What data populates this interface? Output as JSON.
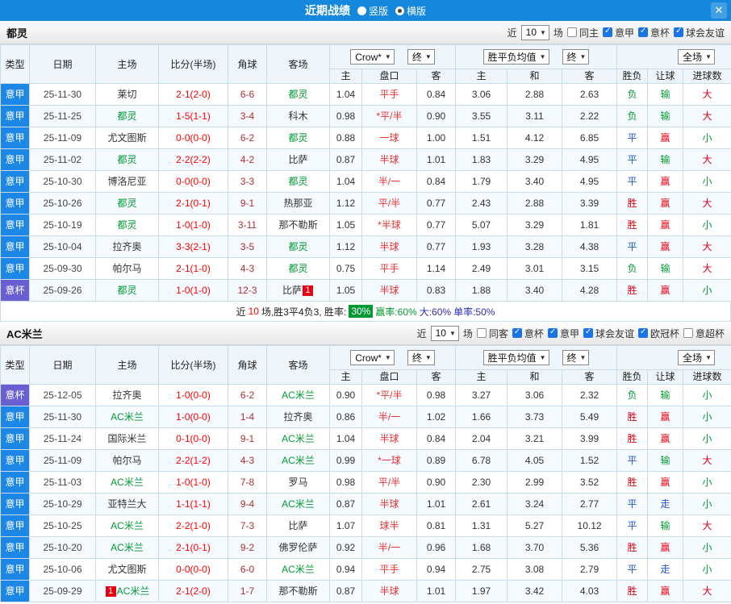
{
  "topbar": {
    "title": "近期战绩",
    "radios": [
      {
        "label": "竖版",
        "selected": false
      },
      {
        "label": "横版",
        "selected": true
      }
    ],
    "close": "✕"
  },
  "colors": {
    "topbar_bg": "#1587dd",
    "league": {
      "意甲": "#1d87e6",
      "意杯": "#6a5fd2"
    },
    "team_highlight": "#009933",
    "score": "#ff0000",
    "corner": "#b03030",
    "handicap_text": "#e83333",
    "result": {
      "胜": "#e60012",
      "平": "#2356c7",
      "负": "#009933"
    },
    "let": {
      "赢": "#e60012",
      "走": "#2356c7",
      "输": "#009933"
    },
    "goals": {
      "大": "#e60012",
      "小": "#009933"
    },
    "summary": {
      "count": "#ff0000",
      "badge_bg": "#009933",
      "win": "#009933",
      "big": "#2d2db8",
      "single": "#2d2db8"
    }
  },
  "table_header": {
    "cols": [
      "类型",
      "日期",
      "主场",
      "比分(半场)",
      "角球",
      "客场"
    ],
    "odds_selects": [
      "Crow*",
      "终"
    ],
    "odds_sub": [
      "主",
      "盘口",
      "客"
    ],
    "avg_selects": [
      "胜平负均值",
      "终"
    ],
    "avg_sub": [
      "主",
      "和",
      "客"
    ],
    "scope_select": "全场",
    "result_sub": [
      "胜负",
      "让球",
      "进球数"
    ]
  },
  "sections": [
    {
      "team": "都灵",
      "filter": {
        "prefix": "近",
        "count": "10",
        "suffix": "场",
        "checks": [
          {
            "label": "同主",
            "checked": false
          },
          {
            "label": "意甲",
            "checked": true
          },
          {
            "label": "意杯",
            "checked": true
          },
          {
            "label": "球会友谊",
            "checked": true
          }
        ]
      },
      "rows": [
        {
          "type": "意甲",
          "date": "25-11-30",
          "home": "莱切",
          "score": "2-1(2-0)",
          "corner": "6-6",
          "away": "都灵",
          "odds": [
            "1.04",
            "平手",
            "0.84"
          ],
          "avg": [
            "3.06",
            "2.88",
            "2.63"
          ],
          "result": "负",
          "let": "输",
          "goals": "大"
        },
        {
          "type": "意甲",
          "date": "25-11-25",
          "home": "都灵",
          "score": "1-5(1-1)",
          "corner": "3-4",
          "away": "科木",
          "odds": [
            "0.98",
            "*平/半",
            "0.90"
          ],
          "avg": [
            "3.55",
            "3.11",
            "2.22"
          ],
          "result": "负",
          "let": "输",
          "goals": "大"
        },
        {
          "type": "意甲",
          "date": "25-11-09",
          "home": "尤文图斯",
          "score": "0-0(0-0)",
          "corner": "6-2",
          "away": "都灵",
          "odds": [
            "0.88",
            "一球",
            "1.00"
          ],
          "avg": [
            "1.51",
            "4.12",
            "6.85"
          ],
          "result": "平",
          "let": "赢",
          "goals": "小"
        },
        {
          "type": "意甲",
          "date": "25-11-02",
          "home": "都灵",
          "score": "2-2(2-2)",
          "corner": "4-2",
          "away": "比萨",
          "odds": [
            "0.87",
            "半球",
            "1.01"
          ],
          "avg": [
            "1.83",
            "3.29",
            "4.95"
          ],
          "result": "平",
          "let": "输",
          "goals": "大"
        },
        {
          "type": "意甲",
          "date": "25-10-30",
          "home": "博洛尼亚",
          "score": "0-0(0-0)",
          "corner": "3-3",
          "away": "都灵",
          "odds": [
            "1.04",
            "半/一",
            "0.84"
          ],
          "avg": [
            "1.79",
            "3.40",
            "4.95"
          ],
          "result": "平",
          "let": "赢",
          "goals": "小"
        },
        {
          "type": "意甲",
          "date": "25-10-26",
          "home": "都灵",
          "score": "2-1(0-1)",
          "corner": "9-1",
          "away": "热那亚",
          "odds": [
            "1.12",
            "平/半",
            "0.77"
          ],
          "avg": [
            "2.43",
            "2.88",
            "3.39"
          ],
          "result": "胜",
          "let": "赢",
          "goals": "大"
        },
        {
          "type": "意甲",
          "date": "25-10-19",
          "home": "都灵",
          "score": "1-0(1-0)",
          "corner": "3-11",
          "away": "那不勒斯",
          "odds": [
            "1.05",
            "*半球",
            "0.77"
          ],
          "avg": [
            "5.07",
            "3.29",
            "1.81"
          ],
          "result": "胜",
          "let": "赢",
          "goals": "小"
        },
        {
          "type": "意甲",
          "date": "25-10-04",
          "home": "拉齐奥",
          "score": "3-3(2-1)",
          "corner": "3-5",
          "away": "都灵",
          "odds": [
            "1.12",
            "半球",
            "0.77"
          ],
          "avg": [
            "1.93",
            "3.28",
            "4.38"
          ],
          "result": "平",
          "let": "赢",
          "goals": "大"
        },
        {
          "type": "意甲",
          "date": "25-09-30",
          "home": "帕尔马",
          "score": "2-1(1-0)",
          "corner": "4-3",
          "away": "都灵",
          "odds": [
            "0.75",
            "平手",
            "1.14"
          ],
          "avg": [
            "2.49",
            "3.01",
            "3.15"
          ],
          "result": "负",
          "let": "输",
          "goals": "大"
        },
        {
          "type": "意杯",
          "date": "25-09-26",
          "home": "都灵",
          "score": "1-0(1-0)",
          "corner": "12-3",
          "away": "比萨",
          "away_badge": "1",
          "odds": [
            "1.05",
            "半球",
            "0.83"
          ],
          "avg": [
            "1.88",
            "3.40",
            "4.28"
          ],
          "result": "胜",
          "let": "赢",
          "goals": "小"
        }
      ],
      "summary": {
        "pre": "近",
        "count": "10",
        "mid": "场,胜3平4负3, 胜率:",
        "badge": "30%",
        "win": "赢率:60%",
        "big": "大:60%",
        "single": "单率:50%"
      }
    },
    {
      "team": "AC米兰",
      "filter": {
        "prefix": "近",
        "count": "10",
        "suffix": "场",
        "checks": [
          {
            "label": "同客",
            "checked": false
          },
          {
            "label": "意杯",
            "checked": true
          },
          {
            "label": "意甲",
            "checked": true
          },
          {
            "label": "球会友谊",
            "checked": true
          },
          {
            "label": "欧冠杯",
            "checked": true
          },
          {
            "label": "意超杯",
            "checked": false
          }
        ]
      },
      "rows": [
        {
          "type": "意杯",
          "date": "25-12-05",
          "home": "拉齐奥",
          "score": "1-0(0-0)",
          "corner": "6-2",
          "away": "AC米兰",
          "odds": [
            "0.90",
            "*平/半",
            "0.98"
          ],
          "avg": [
            "3.27",
            "3.06",
            "2.32"
          ],
          "result": "负",
          "let": "输",
          "goals": "小"
        },
        {
          "type": "意甲",
          "date": "25-11-30",
          "home": "AC米兰",
          "score": "1-0(0-0)",
          "corner": "1-4",
          "away": "拉齐奥",
          "odds": [
            "0.86",
            "半/一",
            "1.02"
          ],
          "avg": [
            "1.66",
            "3.73",
            "5.49"
          ],
          "result": "胜",
          "let": "赢",
          "goals": "小"
        },
        {
          "type": "意甲",
          "date": "25-11-24",
          "home": "国际米兰",
          "score": "0-1(0-0)",
          "corner": "9-1",
          "away": "AC米兰",
          "odds": [
            "1.04",
            "半球",
            "0.84"
          ],
          "avg": [
            "2.04",
            "3.21",
            "3.99"
          ],
          "result": "胜",
          "let": "赢",
          "goals": "小"
        },
        {
          "type": "意甲",
          "date": "25-11-09",
          "home": "帕尔马",
          "score": "2-2(1-2)",
          "corner": "4-3",
          "away": "AC米兰",
          "odds": [
            "0.99",
            "*一球",
            "0.89"
          ],
          "avg": [
            "6.78",
            "4.05",
            "1.52"
          ],
          "result": "平",
          "let": "输",
          "goals": "大"
        },
        {
          "type": "意甲",
          "date": "25-11-03",
          "home": "AC米兰",
          "score": "1-0(1-0)",
          "corner": "7-8",
          "away": "罗马",
          "odds": [
            "0.98",
            "平/半",
            "0.90"
          ],
          "avg": [
            "2.30",
            "2.99",
            "3.52"
          ],
          "result": "胜",
          "let": "赢",
          "goals": "小"
        },
        {
          "type": "意甲",
          "date": "25-10-29",
          "home": "亚特兰大",
          "score": "1-1(1-1)",
          "corner": "9-4",
          "away": "AC米兰",
          "odds": [
            "0.87",
            "半球",
            "1.01"
          ],
          "avg": [
            "2.61",
            "3.24",
            "2.77"
          ],
          "result": "平",
          "let": "走",
          "goals": "小"
        },
        {
          "type": "意甲",
          "date": "25-10-25",
          "home": "AC米兰",
          "score": "2-2(1-0)",
          "corner": "7-3",
          "away": "比萨",
          "odds": [
            "1.07",
            "球半",
            "0.81"
          ],
          "avg": [
            "1.31",
            "5.27",
            "10.12"
          ],
          "result": "平",
          "let": "输",
          "goals": "大"
        },
        {
          "type": "意甲",
          "date": "25-10-20",
          "home": "AC米兰",
          "score": "2-1(0-1)",
          "corner": "9-2",
          "away": "佛罗伦萨",
          "odds": [
            "0.92",
            "半/一",
            "0.96"
          ],
          "avg": [
            "1.68",
            "3.70",
            "5.36"
          ],
          "result": "胜",
          "let": "赢",
          "goals": "小"
        },
        {
          "type": "意甲",
          "date": "25-10-06",
          "home": "尤文图斯",
          "score": "0-0(0-0)",
          "corner": "6-0",
          "away": "AC米兰",
          "odds": [
            "0.94",
            "平手",
            "0.94"
          ],
          "avg": [
            "2.75",
            "3.08",
            "2.79"
          ],
          "result": "平",
          "let": "走",
          "goals": "小"
        },
        {
          "type": "意甲",
          "date": "25-09-29",
          "home": "AC米兰",
          "home_badge": "1",
          "score": "2-1(2-0)",
          "corner": "1-7",
          "away": "那不勒斯",
          "odds": [
            "0.87",
            "半球",
            "1.01"
          ],
          "avg": [
            "1.97",
            "3.42",
            "4.03"
          ],
          "result": "胜",
          "let": "赢",
          "goals": "大"
        }
      ],
      "summary": null
    }
  ]
}
